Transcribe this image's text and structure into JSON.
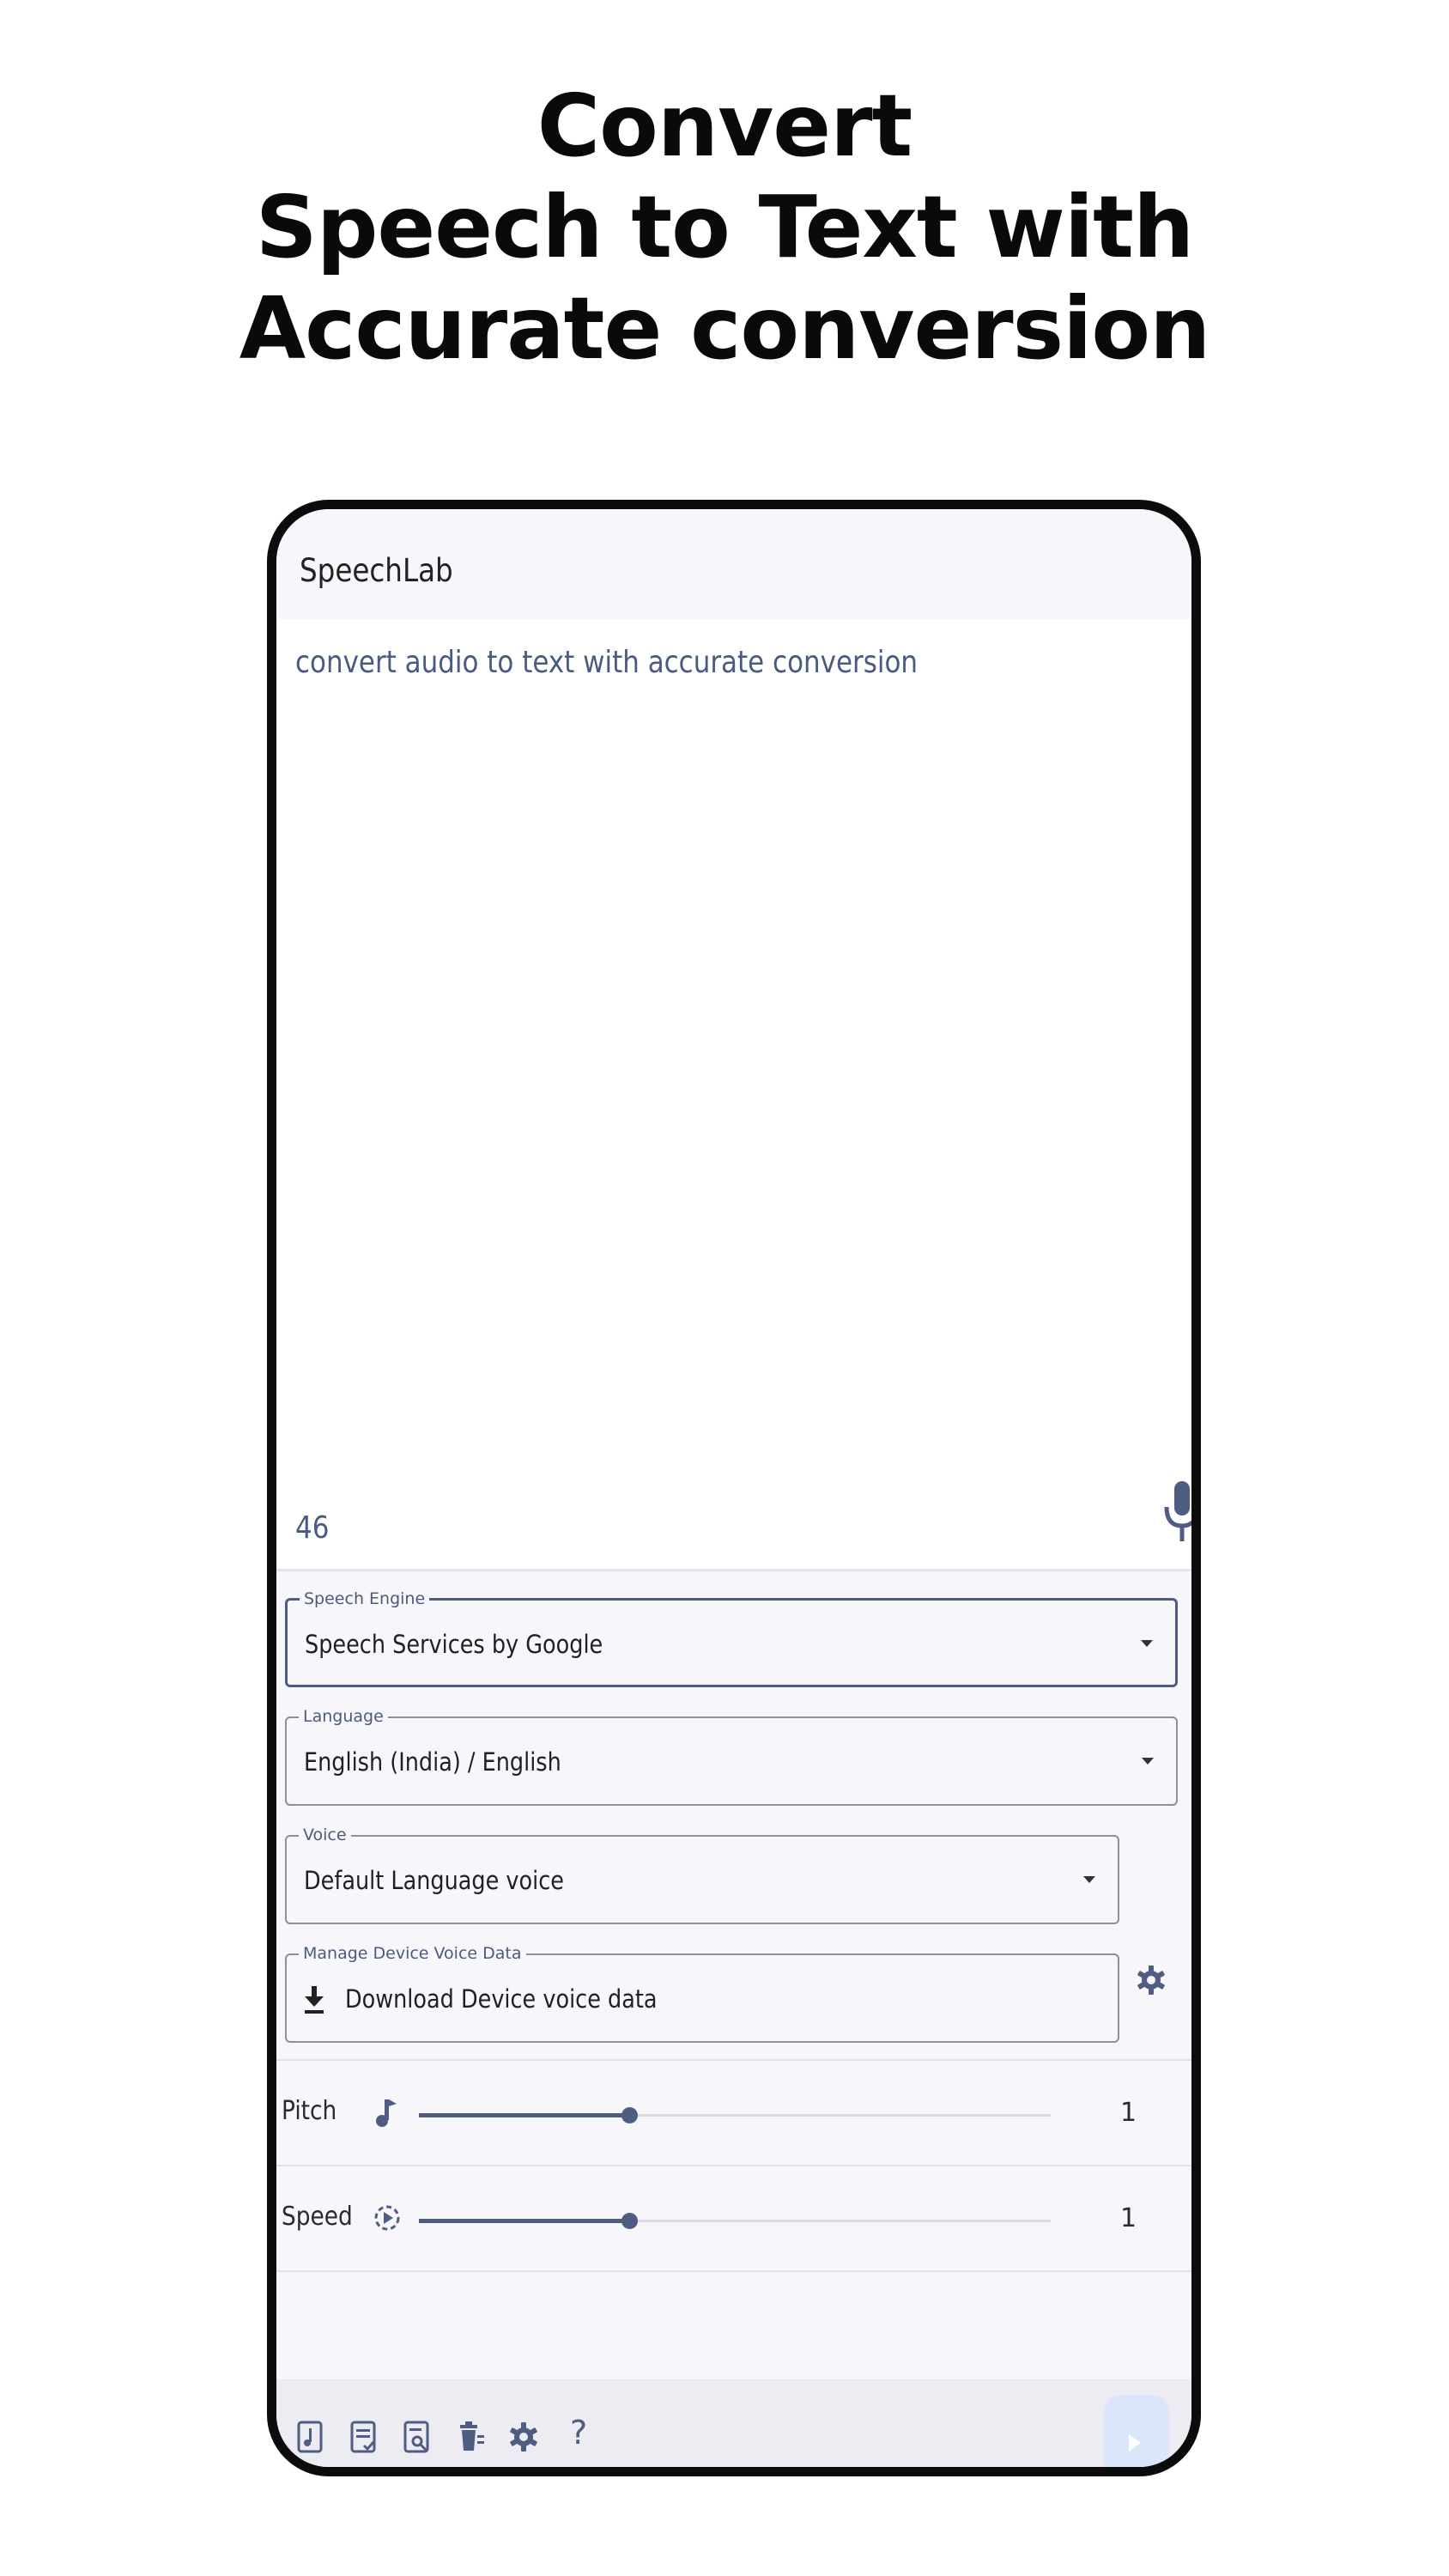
{
  "headline": {
    "line1": "Convert",
    "line2": "Speech to Text with",
    "line3": "Accurate conversion"
  },
  "app": {
    "title": "SpeechLab",
    "editor": {
      "text": "convert audio to text with accurate conversion",
      "char_count": "46"
    },
    "fields": {
      "speech_engine": {
        "label": "Speech Engine",
        "value": "Speech Services by Google"
      },
      "language": {
        "label": "Language",
        "value": "English (India) / English"
      },
      "voice": {
        "label": "Voice",
        "value": "Default Language voice"
      },
      "voice_data": {
        "label": "Manage Device Voice Data",
        "value": "Download Device voice data"
      }
    },
    "sliders": {
      "pitch": {
        "label": "Pitch",
        "value": "1",
        "fraction": 0.333
      },
      "speed": {
        "label": "Speed",
        "value": "1",
        "fraction": 0.333
      }
    },
    "icons": {
      "mic": "microphone-icon",
      "download": "download-icon",
      "settings": "gear-icon",
      "pitch": "music-note-icon",
      "speed": "speed-icon",
      "bottom": [
        "audio-file-icon",
        "text-check-icon",
        "file-search-icon",
        "delete-icon",
        "gear-icon",
        "help-icon"
      ],
      "help_glyph": "?"
    },
    "colors": {
      "accent": "#4f5d82",
      "background": "#f7f7fb",
      "fab": "#dce6fb"
    }
  }
}
